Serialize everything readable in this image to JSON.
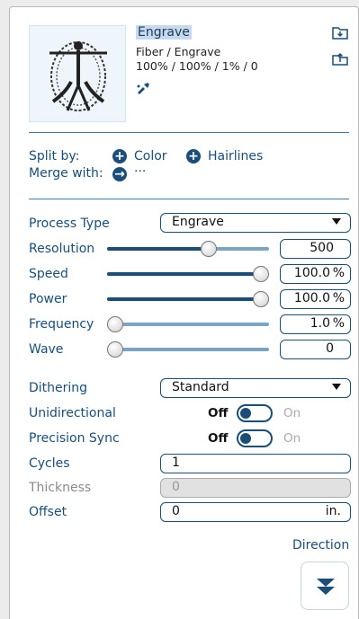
{
  "header": {
    "mode_title": "Engrave",
    "material_line": "Fiber / Engrave",
    "settings_line": "100% / 100% / 1% / 0",
    "import_icon": "folder-import-icon",
    "export_icon": "folder-export-icon",
    "pick_icon": "eyedropper-icon"
  },
  "split": {
    "split_label": "Split by:",
    "color_label": "Color",
    "hairlines_label": "Hairlines",
    "merge_label": "Merge with:",
    "merge_value": "···"
  },
  "process": {
    "process_type_label": "Process Type",
    "process_type_value": "Engrave",
    "rows": [
      {
        "label": "Resolution",
        "value": "500",
        "unit": "",
        "level": 0.64
      },
      {
        "label": "Speed",
        "value": "100.0",
        "unit": "%",
        "level": 1.0
      },
      {
        "label": "Power",
        "value": "100.0",
        "unit": "%",
        "level": 1.0
      },
      {
        "label": "Frequency",
        "value": "1.0",
        "unit": "%",
        "level": 0.0
      },
      {
        "label": "Wave",
        "value": "0",
        "unit": "",
        "level": 0.0
      }
    ]
  },
  "options": {
    "dithering_label": "Dithering",
    "dithering_value": "Standard",
    "unidirectional_label": "Unidirectional",
    "precision_sync_label": "Precision Sync",
    "off_label": "Off",
    "on_label": "On",
    "cycles_label": "Cycles",
    "cycles_value": "1",
    "thickness_label": "Thickness",
    "thickness_value": "0",
    "offset_label": "Offset",
    "offset_value": "0",
    "offset_unit": "in.",
    "direction_label": "Direction",
    "direction_icon": "double-chevron-down-icon"
  },
  "colors": {
    "accent": "#1a4d78",
    "separator": "#3c7aad"
  }
}
